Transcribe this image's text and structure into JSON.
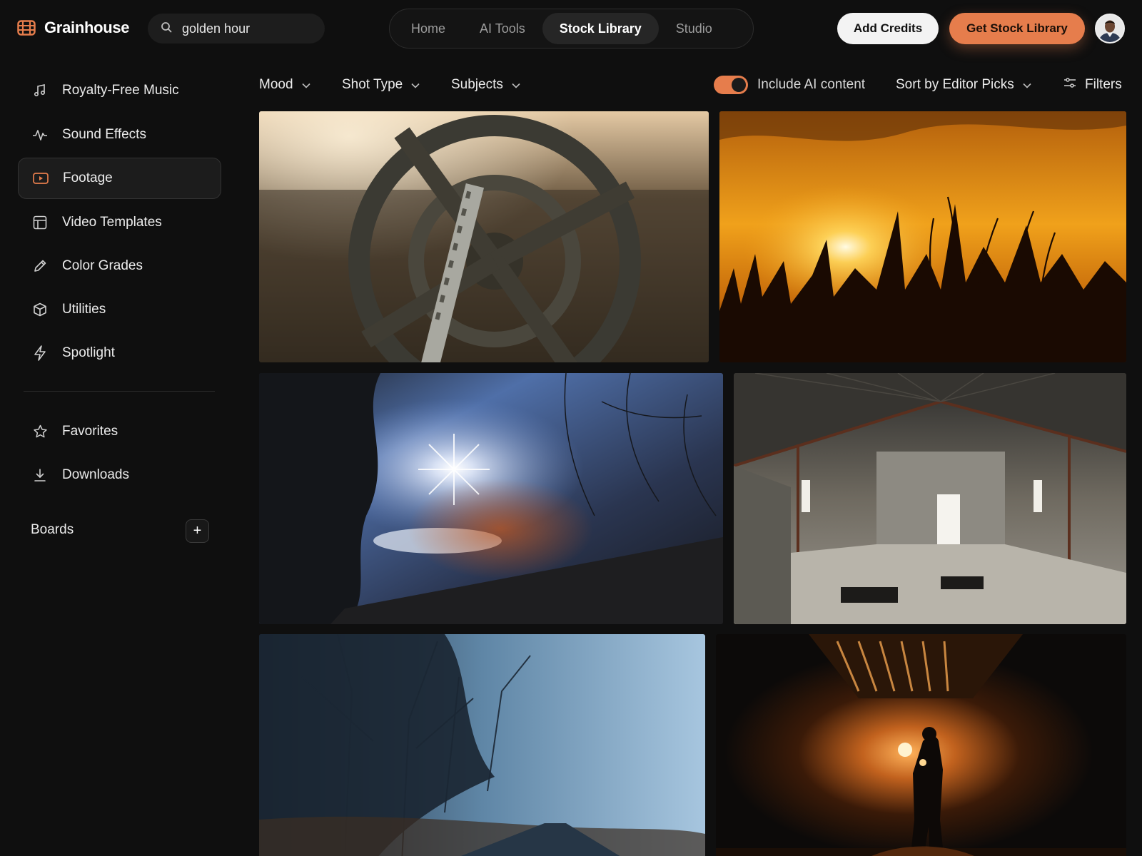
{
  "app": {
    "name": "Grainhouse",
    "brand_color": "#e67d4c"
  },
  "search": {
    "value": "golden hour",
    "icon": "search-icon"
  },
  "nav": {
    "tabs": [
      {
        "label": "Home",
        "active": false
      },
      {
        "label": "AI Tools",
        "active": false
      },
      {
        "label": "Stock Library",
        "active": true
      },
      {
        "label": "Studio",
        "active": false
      }
    ]
  },
  "actions": {
    "add_credits": "Add Credits",
    "get_stock_library": "Get Stock Library"
  },
  "sidebar": {
    "items": [
      {
        "label": "Royalty-Free Music",
        "icon": "music-note-icon",
        "active": false
      },
      {
        "label": "Sound Effects",
        "icon": "waveform-icon",
        "active": false
      },
      {
        "label": "Footage",
        "icon": "play-icon",
        "active": true
      },
      {
        "label": "Video Templates",
        "icon": "template-icon",
        "active": false
      },
      {
        "label": "Color Grades",
        "icon": "pencil-icon",
        "active": false
      },
      {
        "label": "Utilities",
        "icon": "cube-icon",
        "active": false
      },
      {
        "label": "Spotlight",
        "icon": "bolt-icon",
        "active": false
      }
    ],
    "secondary": [
      {
        "label": "Favorites",
        "icon": "star-icon"
      },
      {
        "label": "Downloads",
        "icon": "download-icon"
      }
    ],
    "boards_label": "Boards",
    "boards_add": "+"
  },
  "filters": {
    "mood": "Mood",
    "shot_type": "Shot Type",
    "subjects": "Subjects",
    "include_ai": {
      "label": "Include AI content",
      "on": true
    },
    "sort": "Sort by Editor Picks",
    "filters": "Filters"
  },
  "results": [
    {
      "subject": "film reel close-up"
    },
    {
      "subject": "sunset over grass field"
    },
    {
      "subject": "sunburst through trees"
    },
    {
      "subject": "abandoned warehouse interior"
    },
    {
      "subject": "foggy forest road"
    },
    {
      "subject": "silhouette in lit tunnel"
    }
  ]
}
